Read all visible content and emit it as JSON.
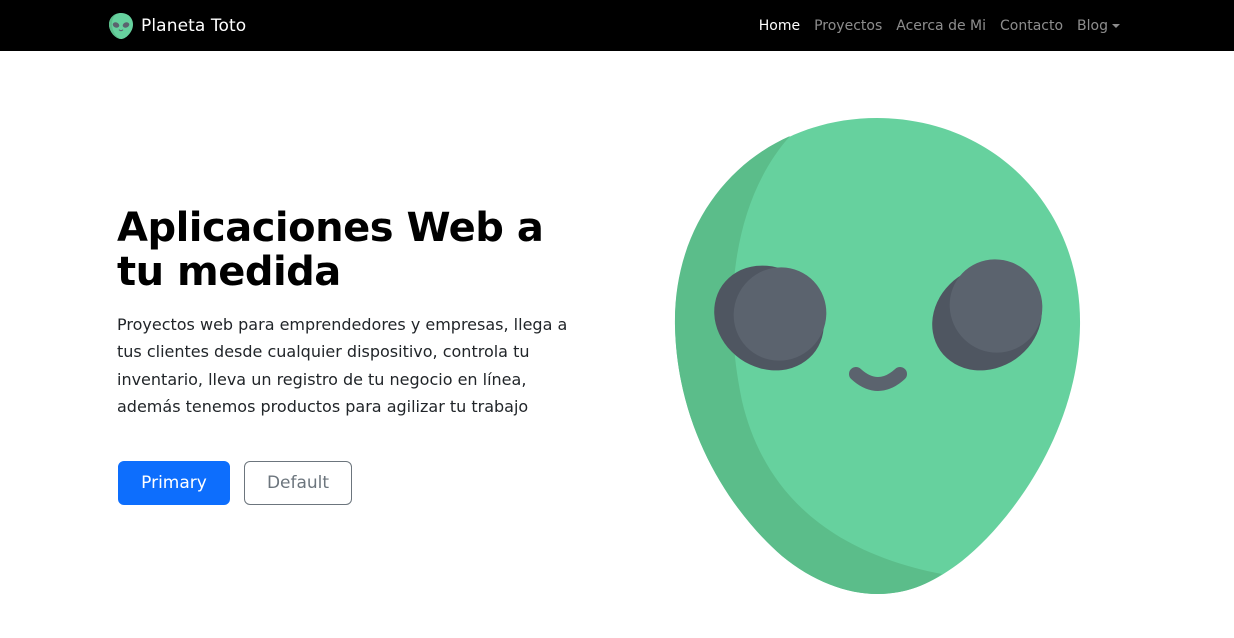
{
  "navbar": {
    "brand": {
      "logo_icon": "alien-head-icon",
      "name": "Planeta Toto"
    },
    "items": [
      {
        "label": "Home",
        "active": true
      },
      {
        "label": "Proyectos",
        "active": false
      },
      {
        "label": "Acerca de Mi",
        "active": false
      },
      {
        "label": "Contacto",
        "active": false
      },
      {
        "label": "Blog",
        "active": false,
        "dropdown": true
      }
    ]
  },
  "hero": {
    "title": "Aplicaciones Web a tu medida",
    "text": "Proyectos web para emprendedores y empresas, llega a tus clientes desde cualquier dispositivo, controla tu inventario, lleva un registro de tu negocio en línea, además tenemos productos para agilizar tu trabajo",
    "buttons": {
      "primary_label": "Primary",
      "default_label": "Default"
    },
    "image_icon": "alien-head-icon"
  },
  "colors": {
    "navbar_bg": "#000000",
    "primary": "#0d6efd",
    "alien_green": "#66d19e",
    "alien_shade": "#5bbd8a",
    "alien_eyes": "#5b636e"
  }
}
